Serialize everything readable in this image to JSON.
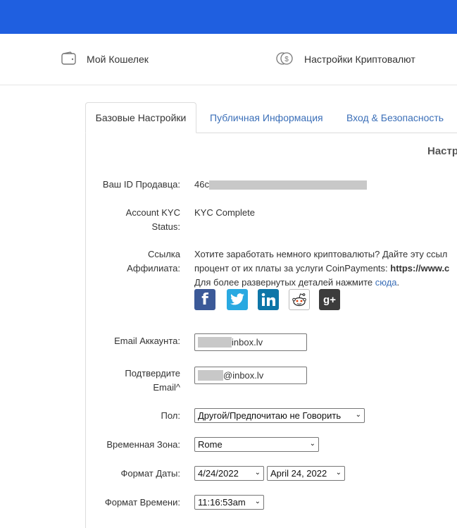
{
  "nav": {
    "wallet_label": "Мой Кошелек",
    "crypto_settings_label": "Настройки Криптовалют"
  },
  "tabs": {
    "basic": "Базовые Настройки",
    "public": "Публичная Информация",
    "security": "Вход & Безопасность"
  },
  "section": {
    "title": "Настр"
  },
  "form": {
    "seller_id_label": "Ваш ID Продавца:",
    "seller_id_value": "46c",
    "kyc_label_line1": "Account KYC",
    "kyc_label_line2": "Status:",
    "kyc_value": "KYC Complete",
    "affiliate_label_line1": "Ссылка",
    "affiliate_label_line2": "Аффилиата:",
    "affiliate_line1": "Хотите заработать немного криптовалюты? Дайте эту ссыл",
    "affiliate_line2_prefix": "процент от их платы за услуги CoinPayments: ",
    "affiliate_line2_link": "https://www.c",
    "affiliate_line3_prefix": "Для более развернутых деталей нажмите ",
    "affiliate_line3_link": "сюда",
    "affiliate_line3_suffix": ".",
    "email_label": "Email Аккаунта:",
    "email_value": "inbox.lv",
    "confirm_label_line1": "Подтвердите",
    "confirm_label_line2": "Email^",
    "confirm_value": "@inbox.lv",
    "gender_label": "Пол:",
    "gender_value": "Другой/Предпочитаю не Говорить",
    "timezone_label": "Временная Зона:",
    "timezone_value": "Rome",
    "date_format_label": "Формат Даты:",
    "date_format_short": "4/24/2022",
    "date_format_long": "April 24, 2022",
    "time_format_label": "Формат Времени:",
    "time_format_value": "11:16:53am"
  },
  "social": {
    "facebook": "f",
    "googleplus": "g+"
  },
  "colors": {
    "topbar": "#1f5fe0",
    "link": "#3b6fb8",
    "facebook": "#3b5998",
    "twitter": "#29a9e1",
    "linkedin": "#0e76a8",
    "googleplus": "#3c3c3c"
  }
}
